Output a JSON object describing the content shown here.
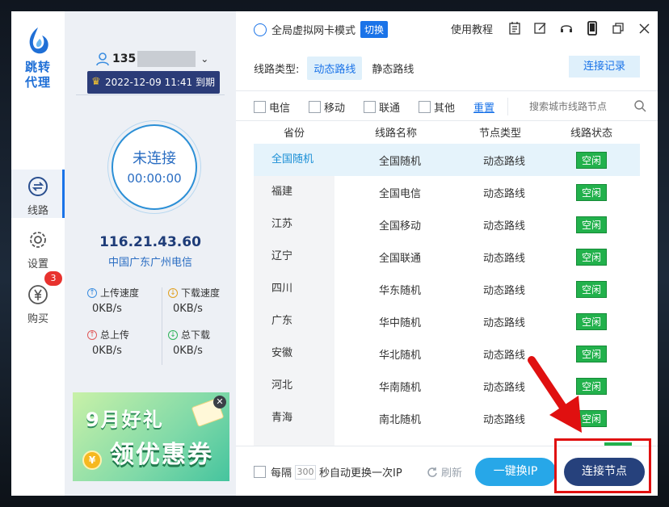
{
  "app": {
    "logo_text_1": "跳转",
    "logo_text_2": "代理"
  },
  "nav": {
    "items": [
      {
        "label": "线路",
        "icon": "route-switch-icon",
        "active": true
      },
      {
        "label": "设置",
        "icon": "gear-icon",
        "active": false
      },
      {
        "label": "购买",
        "icon": "yen-icon",
        "active": false,
        "badge": "3"
      }
    ]
  },
  "account": {
    "username": "135",
    "expire": "2022-12-09 11:41 到期",
    "status": "未连接",
    "timer": "00:00:00",
    "ip": "116.21.43.60",
    "isp": "中国广东广州电信",
    "upload_speed_label": "上传速度",
    "upload_speed": "0KB/s",
    "download_speed_label": "下载速度",
    "download_speed": "0KB/s",
    "total_upload_label": "总上传",
    "total_upload": "0KB/s",
    "total_download_label": "总下载",
    "total_download": "0KB/s"
  },
  "ad": {
    "line1": "9月好礼",
    "line2": "领优惠券",
    "coin": "¥"
  },
  "topbar": {
    "mode_label": "全局虚拟网卡模式",
    "switch_label": "切换",
    "tutorial_label": "使用教程"
  },
  "route": {
    "type_label": "线路类型:",
    "dynamic_label": "动态路线",
    "static_label": "静态路线",
    "record_label": "连接记录"
  },
  "filters": {
    "options": [
      "电信",
      "移动",
      "联通",
      "其他"
    ],
    "reset_label": "重置",
    "search_placeholder": "搜索城市线路节点"
  },
  "table": {
    "headers": [
      "省份",
      "线路名称",
      "节点类型",
      "线路状态"
    ],
    "rows": [
      {
        "province": "全国随机",
        "line": "全国随机",
        "type": "动态路线",
        "status": "空闲"
      },
      {
        "province": "福建",
        "line": "全国电信",
        "type": "动态路线",
        "status": "空闲"
      },
      {
        "province": "江苏",
        "line": "全国移动",
        "type": "动态路线",
        "status": "空闲"
      },
      {
        "province": "辽宁",
        "line": "全国联通",
        "type": "动态路线",
        "status": "空闲"
      },
      {
        "province": "四川",
        "line": "华东随机",
        "type": "动态路线",
        "status": "空闲"
      },
      {
        "province": "广东",
        "line": "华中随机",
        "type": "动态路线",
        "status": "空闲"
      },
      {
        "province": "安徽",
        "line": "华北随机",
        "type": "动态路线",
        "status": "空闲"
      },
      {
        "province": "河北",
        "line": "华南随机",
        "type": "动态路线",
        "status": "空闲"
      },
      {
        "province": "青海",
        "line": "南北随机",
        "type": "动态路线",
        "status": "空闲"
      }
    ]
  },
  "bottom": {
    "every_label": "每隔",
    "seconds_value": "300",
    "auto_label": "秒自动更换一次IP",
    "refresh_label": "刷新",
    "one_key_label": "一键换IP",
    "connect_label": "连接节点"
  },
  "colors": {
    "accent": "#1a73e8",
    "navy": "#26417c",
    "free_green": "#22b14c",
    "highlight_red": "#e01010"
  }
}
